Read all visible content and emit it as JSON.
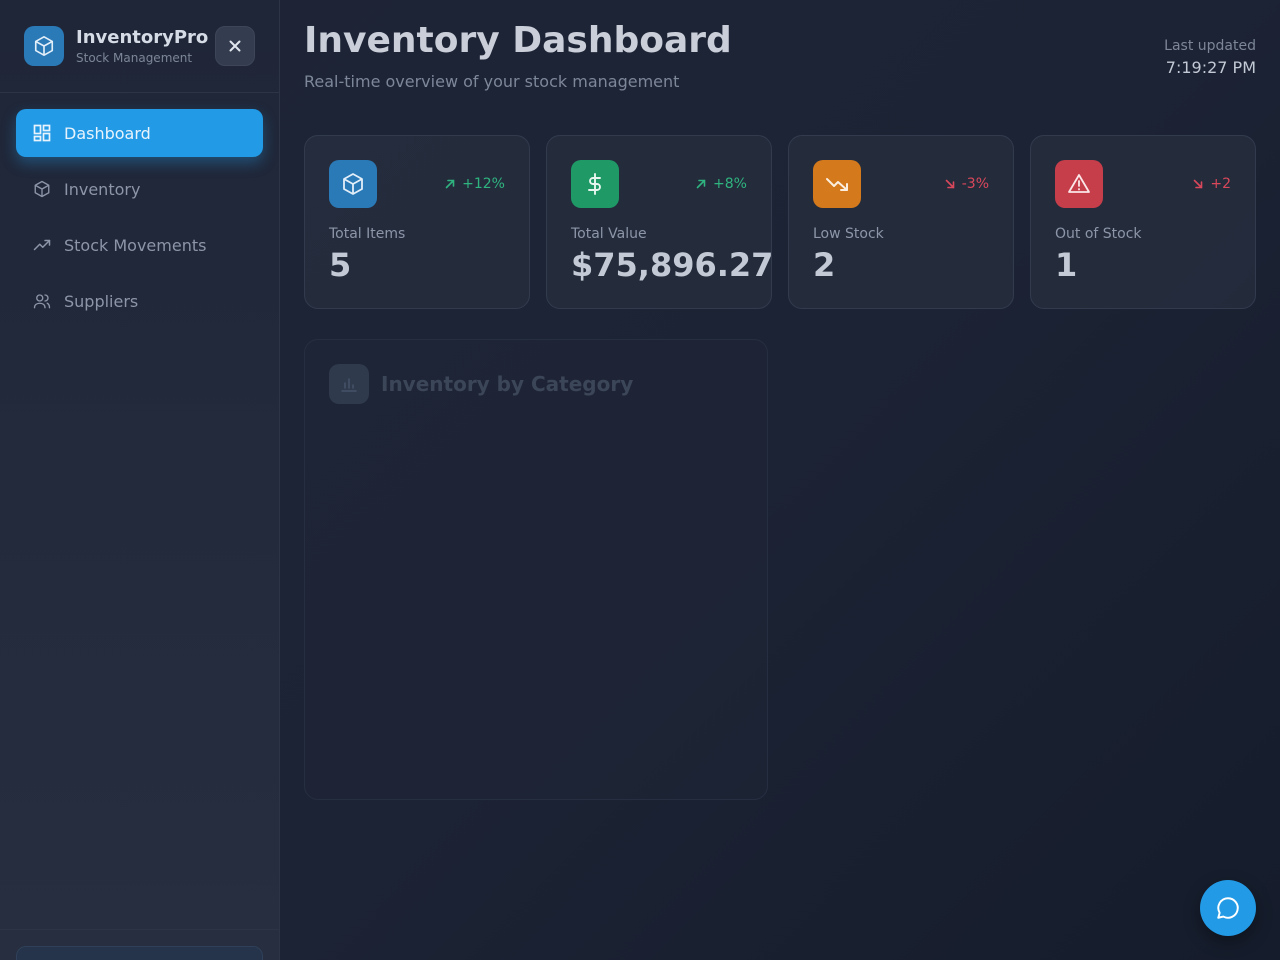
{
  "brand": {
    "title": "InventoryPro",
    "subtitle": "Stock Management"
  },
  "nav": [
    {
      "label": "Dashboard",
      "icon": "dashboard-icon",
      "active": true
    },
    {
      "label": "Inventory",
      "icon": "package-icon",
      "active": false
    },
    {
      "label": "Stock Movements",
      "icon": "trending-up-icon",
      "active": false
    },
    {
      "label": "Suppliers",
      "icon": "users-icon",
      "active": false
    }
  ],
  "header": {
    "title": "Inventory Dashboard",
    "subtitle": "Real-time overview of your stock management",
    "updated_label": "Last updated",
    "updated_time": "7:19:27 PM"
  },
  "stats": [
    {
      "label": "Total Items",
      "value": "5",
      "trend": "+12%",
      "trend_dir": "up",
      "icon": "package-icon",
      "color": "#2a7ab8"
    },
    {
      "label": "Total Value",
      "value": "$75,896.27",
      "trend": "+8%",
      "trend_dir": "up",
      "icon": "dollar-icon",
      "color": "#1f9a67"
    },
    {
      "label": "Low Stock",
      "value": "2",
      "trend": "-3%",
      "trend_dir": "down",
      "icon": "trending-down-icon",
      "color": "#d47a1c"
    },
    {
      "label": "Out of Stock",
      "value": "1",
      "trend": "+2",
      "trend_dir": "down",
      "icon": "alert-triangle-icon",
      "color": "#c73e4b"
    }
  ],
  "chart_card": {
    "title": "Inventory by Category",
    "icon": "bar-chart-icon"
  },
  "fab": {
    "icon": "chat-icon"
  },
  "colors": {
    "accent": "#229ae6",
    "up": "#2fb37f",
    "down": "#d9475a"
  }
}
